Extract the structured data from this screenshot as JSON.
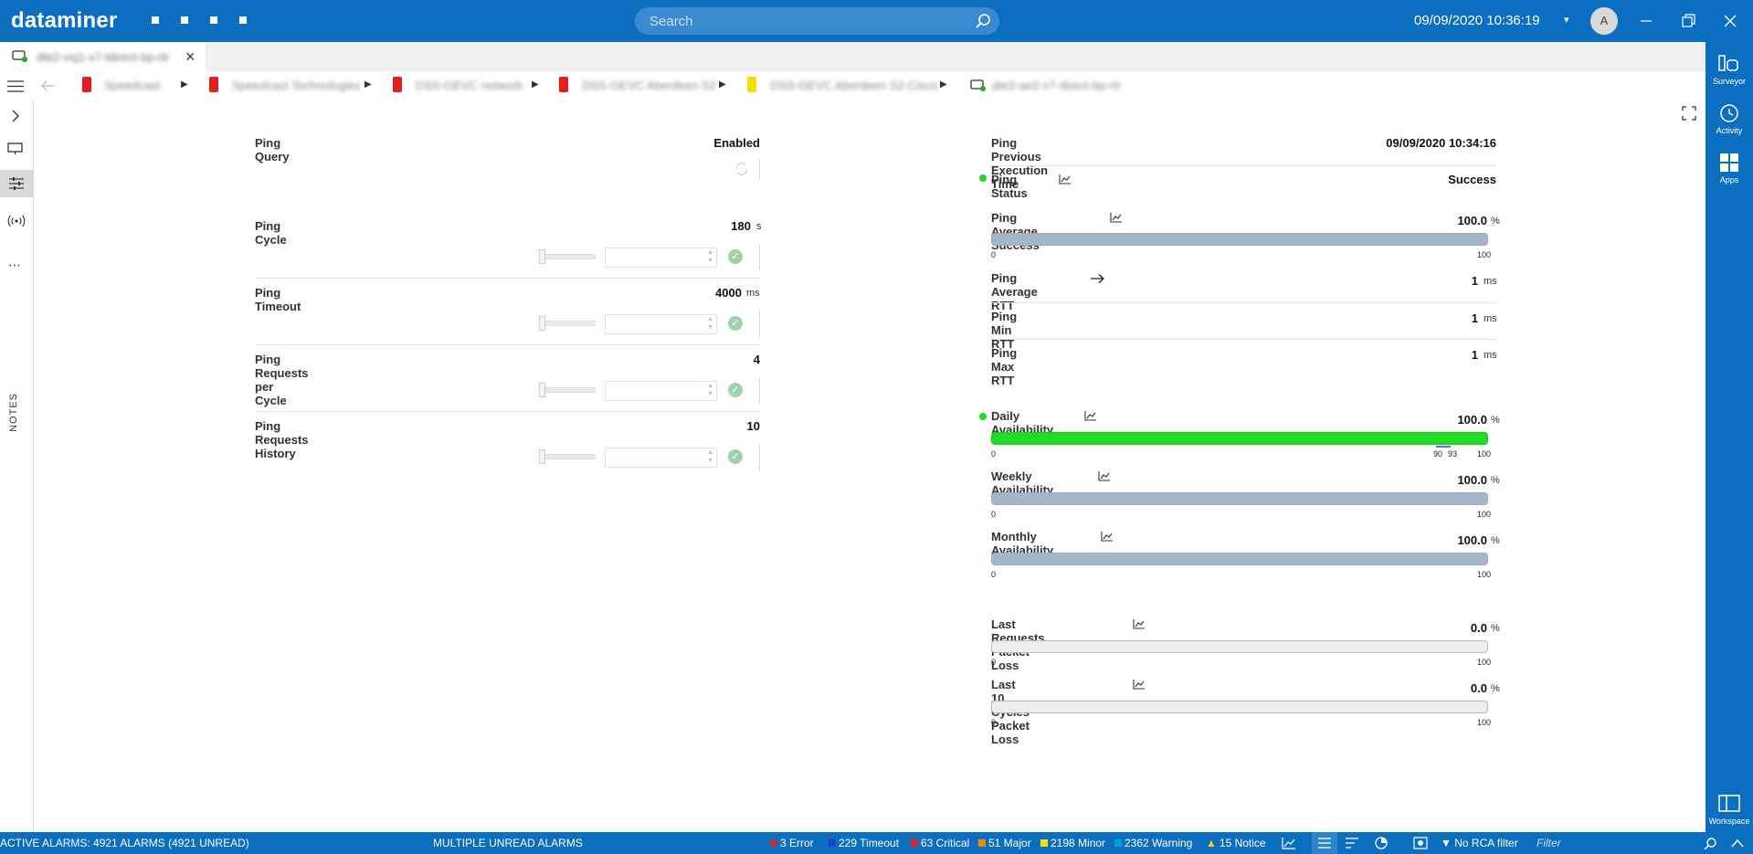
{
  "app": {
    "brand": "dataminer",
    "search_placeholder": "Search",
    "datetime": "09/09/2020 10:36:19",
    "avatar_initial": "A"
  },
  "right_rail": [
    {
      "label": "Surveyor",
      "icon": "surveyor-icon"
    },
    {
      "label": "Activity",
      "icon": "activity-icon"
    },
    {
      "label": "Apps",
      "icon": "apps-icon"
    },
    {
      "label": "Workspace",
      "icon": "workspace-icon"
    }
  ],
  "tab": {
    "label": "dte2-vxj1-v7-ldirect-bp-rtr"
  },
  "breadcrumb": [
    {
      "label": "Speedcast",
      "color": "#e02020"
    },
    {
      "label": "Speedcast Technologies",
      "color": "#e02020"
    },
    {
      "label": "DSS-GEVC network",
      "color": "#e02020"
    },
    {
      "label": "DSS-GEVC Aberdeen S2",
      "color": "#e02020"
    },
    {
      "label": "DSS-GEVC Aberdeen S2-Cisco",
      "color": "#f0e000"
    },
    {
      "label": "dte2-ae2-v7-direct-bp-rtr",
      "color": "#22aa22"
    }
  ],
  "sidebar": {
    "notes_label": "NOTES"
  },
  "left_params": {
    "ping_query": {
      "label": "Ping Query",
      "value": "Enabled"
    },
    "ping_cycle": {
      "label": "Ping Cycle",
      "value": "180",
      "unit": "s"
    },
    "ping_timeout": {
      "label": "Ping Timeout",
      "value": "4000",
      "unit": "ms"
    },
    "ping_requests": {
      "label": "Ping Requests per Cycle",
      "value": "4"
    },
    "ping_history": {
      "label": "Ping Requests History",
      "value": "10"
    }
  },
  "right_params": {
    "prev_exec": {
      "label": "Ping Previous Execution Time",
      "value": "09/09/2020 10:34:16"
    },
    "status": {
      "label": "Ping Status",
      "value": "Success"
    },
    "avg_success": {
      "label": "Ping Average Success",
      "value": "100.0",
      "unit": "%",
      "min": "0",
      "max": "100",
      "fraction": 1.0
    },
    "avg_rtt": {
      "label": "Ping Average RTT",
      "value": "1",
      "unit": "ms"
    },
    "min_rtt": {
      "label": "Ping Min RTT",
      "value": "1",
      "unit": "ms"
    },
    "max_rtt": {
      "label": "Ping Max RTT",
      "value": "1",
      "unit": "ms"
    },
    "daily": {
      "label": "Daily Availability",
      "value": "100.0",
      "unit": "%",
      "min": "0",
      "max": "100",
      "t1": "90",
      "t2": "93",
      "fraction": 1.0
    },
    "weekly": {
      "label": "Weekly Availability",
      "value": "100.0",
      "unit": "%",
      "min": "0",
      "max": "100",
      "fraction": 1.0
    },
    "monthly": {
      "label": "Monthly Availability",
      "value": "100.0",
      "unit": "%",
      "min": "0",
      "max": "100",
      "fraction": 1.0
    },
    "last_loss": {
      "label": "Last Requests Packet Loss",
      "value": "0.0",
      "unit": "%",
      "min": "0",
      "max": "100",
      "fraction": 0.0
    },
    "cycles_loss": {
      "label": "Last 10 Cycles Packet Loss",
      "value": "0.0",
      "unit": "%",
      "min": "0",
      "max": "100",
      "fraction": 0.0
    }
  },
  "status_bar": {
    "active_alarms": "ACTIVE ALARMS: 4921 ALARMS (4921 UNREAD)",
    "multiple_unread": "MULTIPLE UNREAD ALARMS",
    "counts": [
      {
        "label": "3 Error",
        "color": "#e02020"
      },
      {
        "label": "229 Timeout",
        "color": "#2b3cd6"
      },
      {
        "label": "63 Critical",
        "color": "#e02020"
      },
      {
        "label": "51 Major",
        "color": "#f08c00"
      },
      {
        "label": "2198 Minor",
        "color": "#f0e000"
      },
      {
        "label": "2362 Warning",
        "color": "#00a0e0"
      },
      {
        "label": "15 Notice",
        "color": "#ffd000"
      }
    ],
    "rca": "No RCA filter",
    "filter_placeholder": "Filter"
  }
}
